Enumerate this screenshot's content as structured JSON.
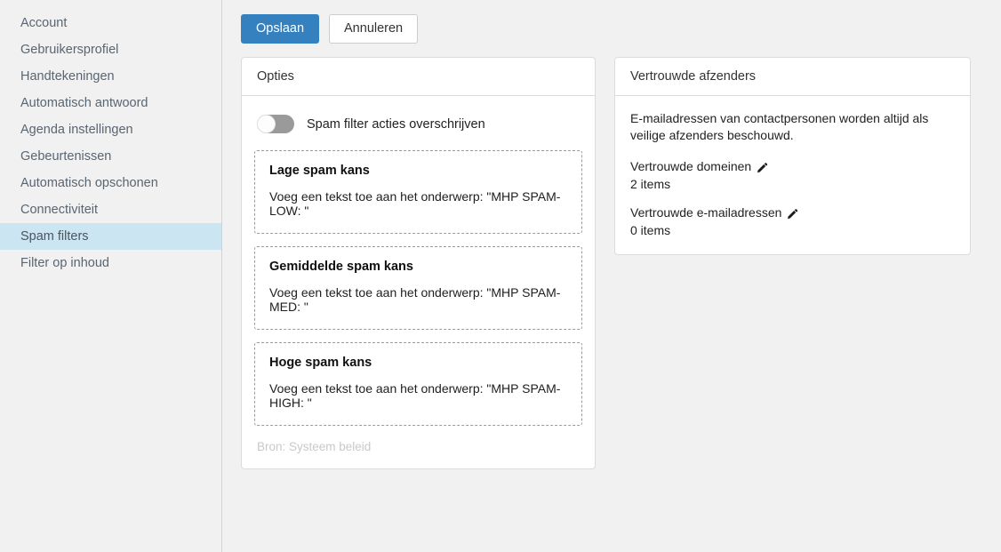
{
  "sidebar": {
    "items": [
      {
        "label": "Account",
        "selected": false
      },
      {
        "label": "Gebruikersprofiel",
        "selected": false
      },
      {
        "label": "Handtekeningen",
        "selected": false
      },
      {
        "label": "Automatisch antwoord",
        "selected": false
      },
      {
        "label": "Agenda instellingen",
        "selected": false
      },
      {
        "label": "Gebeurtenissen",
        "selected": false
      },
      {
        "label": "Automatisch opschonen",
        "selected": false
      },
      {
        "label": "Connectiviteit",
        "selected": false
      },
      {
        "label": "Spam filters",
        "selected": true
      },
      {
        "label": "Filter op inhoud",
        "selected": false
      }
    ]
  },
  "toolbar": {
    "save_label": "Opslaan",
    "cancel_label": "Annuleren",
    "primary_color": "#3581c0"
  },
  "options_panel": {
    "title": "Opties",
    "toggle": {
      "label": "Spam filter acties overschrijven",
      "state": "off",
      "icon": "toggle-switch-off-icon"
    },
    "spam_boxes": [
      {
        "title": "Lage spam kans",
        "description": "Voeg een tekst toe aan het onderwerp: \"MHP SPAM-LOW: \""
      },
      {
        "title": "Gemiddelde spam kans",
        "description": "Voeg een tekst toe aan het onderwerp: \"MHP SPAM-MED: \""
      },
      {
        "title": "Hoge spam kans",
        "description": "Voeg een tekst toe aan het onderwerp: \"MHP SPAM-HIGH: \""
      }
    ],
    "source_note": "Bron: Systeem beleid"
  },
  "trusted_panel": {
    "title": "Vertrouwde afzenders",
    "intro": "E-mailadressen van contactpersonen worden altijd als veilige afzenders beschouwd.",
    "groups": [
      {
        "label": "Vertrouwde domeinen",
        "count": "2 items",
        "edit_icon": "pencil-icon"
      },
      {
        "label": "Vertrouwde e-mailadressen",
        "count": "0 items",
        "edit_icon": "pencil-icon"
      }
    ]
  }
}
